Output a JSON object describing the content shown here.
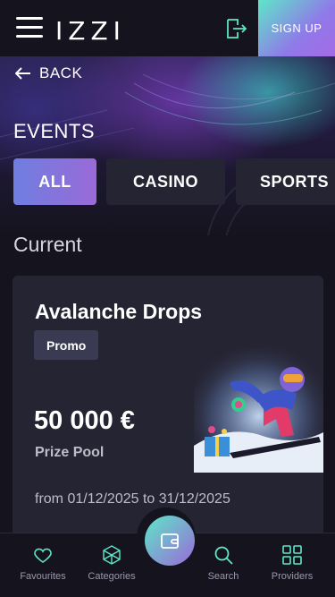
{
  "header": {
    "logo_text": "IZZI",
    "signup_label": "SIGN UP",
    "menu_icon": "hamburger-menu-icon",
    "login_icon": "login-door-icon"
  },
  "nav": {
    "back_label": "BACK"
  },
  "events": {
    "title": "EVENTS",
    "tabs": [
      {
        "label": "ALL",
        "active": true
      },
      {
        "label": "CASINO",
        "active": false
      },
      {
        "label": "SPORTS",
        "active": false
      }
    ]
  },
  "section": {
    "current_title": "Current"
  },
  "card": {
    "title": "Avalanche Drops",
    "badge": "Promo",
    "prize_amount": "50 000 €",
    "prize_label": "Prize Pool",
    "date_range": "from 01/12/2025 to 31/12/2025"
  },
  "bottom_nav": {
    "items": [
      {
        "label": "Favourites",
        "icon": "heart-icon"
      },
      {
        "label": "Categories",
        "icon": "categories-icon"
      },
      {
        "label": "Search",
        "icon": "search-icon"
      },
      {
        "label": "Providers",
        "icon": "grid-icon"
      }
    ],
    "center_icon": "wallet-icon"
  },
  "colors": {
    "background": "#15141e",
    "card": "#252433",
    "accent_start": "#5ee6c8",
    "accent_end": "#9a6ad8",
    "muted_text": "#bdbdc8"
  }
}
